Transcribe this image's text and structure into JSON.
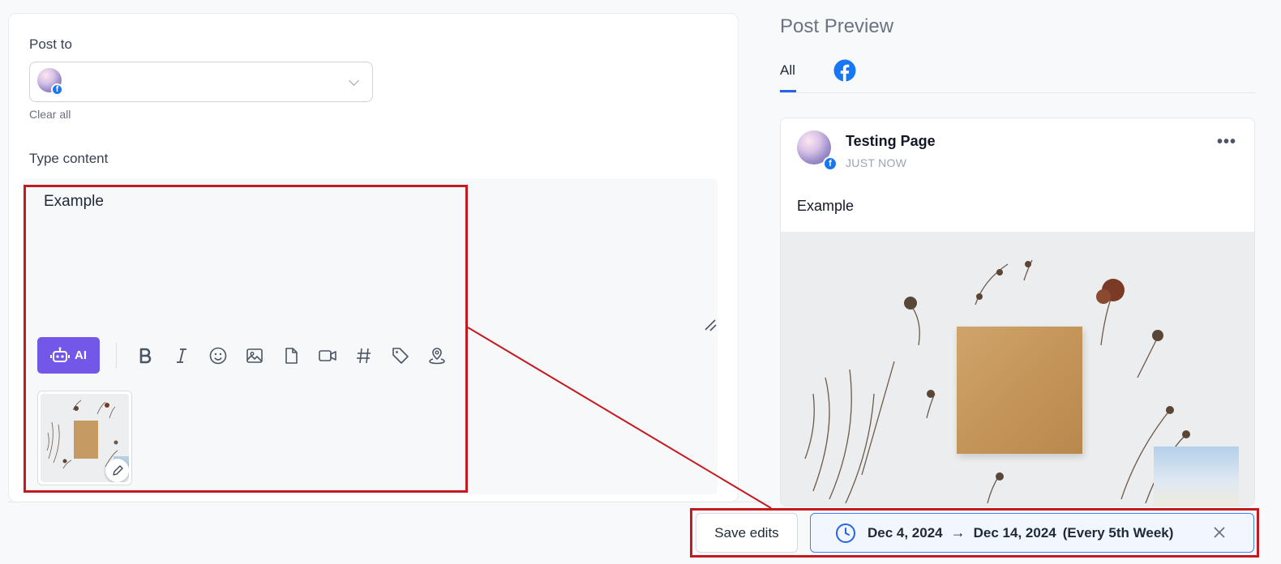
{
  "editor": {
    "post_to_label": "Post to",
    "clear_all": "Clear all",
    "type_content_label": "Type content",
    "content_text": "Example",
    "ai_button_label": "AI",
    "toolbar_icons": [
      "bold-icon",
      "italic-icon",
      "emoji-icon",
      "image-icon",
      "file-icon",
      "video-icon",
      "hashtag-icon",
      "tag-icon",
      "location-icon"
    ]
  },
  "actions": {
    "save_label": "Save edits",
    "schedule_start": "Dec 4, 2024",
    "schedule_arrow": "→",
    "schedule_end": "Dec 14, 2024",
    "schedule_frequency": "(Every 5th Week)"
  },
  "preview": {
    "title": "Post Preview",
    "tab_all": "All",
    "page_name": "Testing Page",
    "timestamp": "JUST NOW",
    "more": "•••",
    "post_text": "Example"
  },
  "colors": {
    "ai_purple": "#7357e8",
    "facebook_blue": "#1877f2",
    "accent_blue": "#2563eb",
    "highlight_red": "#c41a1f"
  }
}
